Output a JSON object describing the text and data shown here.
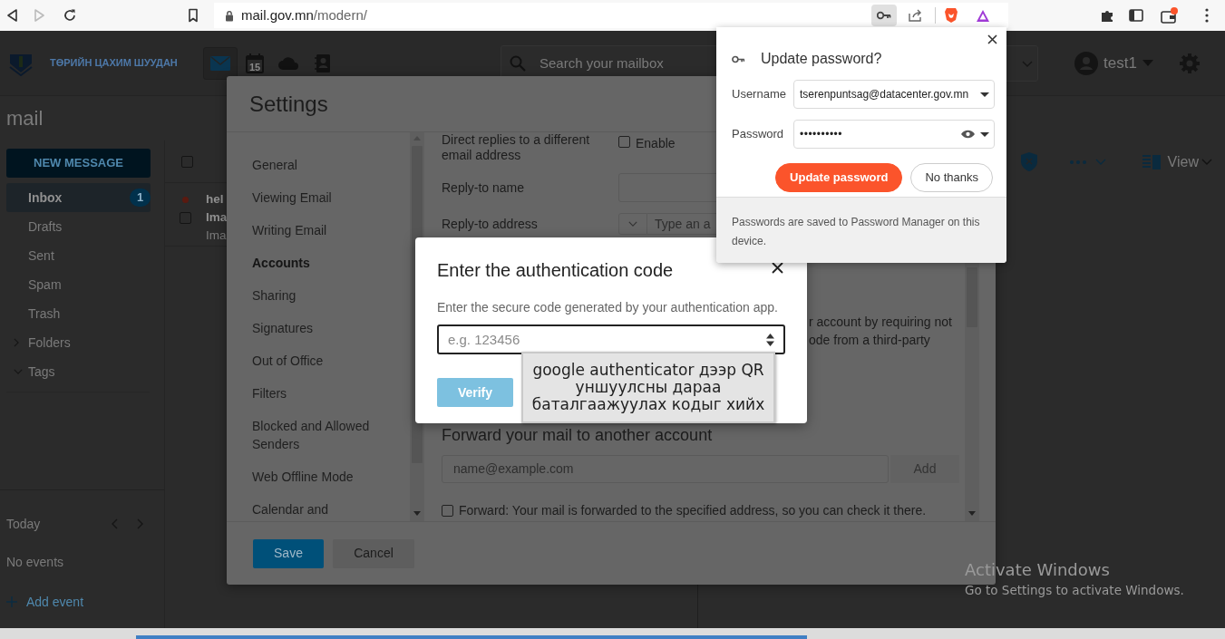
{
  "browser": {
    "url_domain": "mail.gov.mn",
    "url_path": "/modern/"
  },
  "app": {
    "brand": "ТӨРИЙН ЦАХИМ ШУУДАН",
    "calendar_day": "15",
    "search": {
      "placeholder": "Search your mailbox"
    },
    "user": "test1",
    "page_title": "mail"
  },
  "sidebar": {
    "new_message": "NEW MESSAGE",
    "folders": [
      {
        "kind": "folder",
        "label": "Inbox",
        "count": "1",
        "selected": true
      },
      {
        "kind": "folder",
        "label": "Drafts",
        "selected": false
      },
      {
        "kind": "folder",
        "label": "Sent",
        "selected": false
      },
      {
        "kind": "folder",
        "label": "Spam",
        "selected": false
      },
      {
        "kind": "folder",
        "label": "Trash",
        "selected": false
      },
      {
        "kind": "group",
        "label": "Folders",
        "selected": false,
        "expanded": false
      },
      {
        "kind": "group",
        "label": "Tags",
        "selected": false,
        "expanded": true
      }
    ],
    "calendar": {
      "label": "Today",
      "empty": "No events",
      "add": "Add event"
    }
  },
  "message_list": {
    "select_all_checked": false,
    "rows": [
      {
        "unread": true,
        "checked": false,
        "sender": "hel",
        "subject": "Ima",
        "preview": "Ima"
      }
    ]
  },
  "toolbar": {
    "view": "View"
  },
  "settings": {
    "title": "Settings",
    "nav": [
      {
        "label": "General",
        "selected": false
      },
      {
        "label": "Viewing Email",
        "selected": false
      },
      {
        "label": "Writing Email",
        "selected": false
      },
      {
        "label": "Accounts",
        "selected": true
      },
      {
        "label": "Sharing",
        "selected": false
      },
      {
        "label": "Signatures",
        "selected": false
      },
      {
        "label": "Out of Office",
        "selected": false
      },
      {
        "label": "Filters",
        "selected": false
      },
      {
        "label": "Blocked and Allowed Senders",
        "selected": false
      },
      {
        "label": "Web Offline Mode",
        "selected": false
      },
      {
        "label": "Calendar and",
        "selected": false
      }
    ],
    "content": {
      "reply_direct": {
        "label": "Direct replies to a different email address",
        "option": "Enable",
        "checked": false
      },
      "reply_name": {
        "label": "Reply-to name"
      },
      "reply_address": {
        "label": "Reply-to address",
        "placeholder": "Type an a"
      },
      "partial_lines": [
        "r account by requiring not",
        "ode from a third-party"
      ],
      "forward": {
        "heading": "Forward your mail to another account",
        "placeholder": "name@example.com",
        "add": "Add",
        "add_disabled": true,
        "option": "Forward: Your mail is forwarded to the specified address, so you can check it there.",
        "checked": false
      }
    },
    "buttons": {
      "save": "Save",
      "cancel": "Cancel"
    }
  },
  "auth_dialog": {
    "title": "Enter the authentication code",
    "description": "Enter the secure code generated by your authentication app.",
    "placeholder": "e.g. 123456",
    "verify": "Verify",
    "verify_disabled": true,
    "tooltip": "google authenticator дээр QR уншуулсны дараа баталгаажуулах кодыг хийх"
  },
  "password_popup": {
    "title": "Update password?",
    "fields": [
      {
        "kind": "text",
        "label": "Username",
        "value": "tserenpuntsag@datacenter.gov.mn"
      },
      {
        "kind": "password",
        "label": "Password",
        "value": "••••••••••"
      }
    ],
    "buttons": [
      {
        "label": "Update password",
        "primary": true
      },
      {
        "label": "No thanks",
        "primary": false
      }
    ],
    "footer": {
      "before": "Passwords are saved to",
      "link": "Password Manager",
      "after": "on this device."
    }
  },
  "os_notice": {
    "title": "Activate Windows",
    "text": "Go to Settings to activate Windows."
  }
}
